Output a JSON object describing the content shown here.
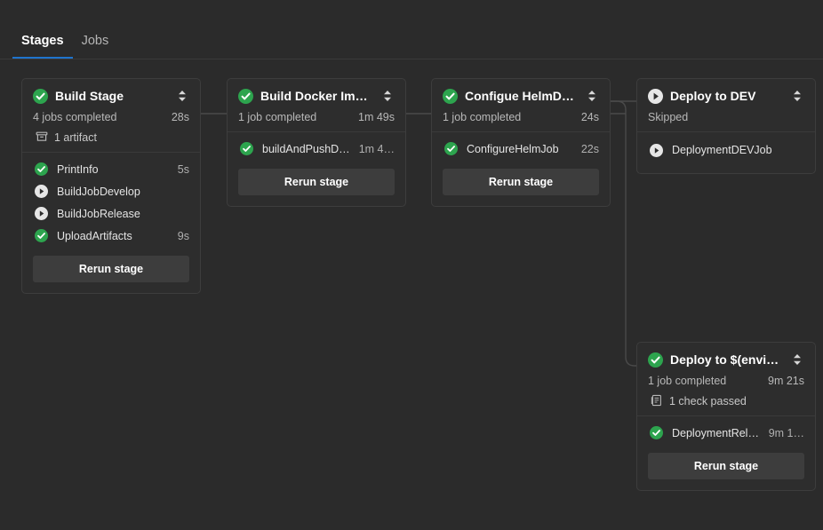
{
  "theme": {
    "background": "#2b2b2b",
    "card_background": "#2d2d2d",
    "border": "#3d3d3d",
    "accent": "#1f74cd",
    "success": "#2da44e",
    "button": "#3d3d3d",
    "text_primary": "#ffffff",
    "text_secondary": "#b8b8b8"
  },
  "tabs": [
    {
      "label": "Stages",
      "name": "tab-stages",
      "active": true
    },
    {
      "label": "Jobs",
      "name": "tab-jobs",
      "active": false
    }
  ],
  "labels": {
    "rerun_stage": "Rerun stage",
    "toggle_icon": "chevron-up-down-icon",
    "success_icon": "check-circle-icon",
    "skipped_icon": "skipped-circle-icon",
    "artifact_icon": "artifact-box-icon",
    "check_icon": "checklist-icon"
  },
  "stages": [
    {
      "id": "build-stage",
      "title": "Build Stage",
      "status": "success",
      "summary": "4 jobs completed",
      "duration": "28s",
      "extra": {
        "icon": "artifact-box-icon",
        "text": "1 artifact"
      },
      "jobs": [
        {
          "name": "PrintInfo",
          "status": "success",
          "duration": "5s"
        },
        {
          "name": "BuildJobDevelop",
          "status": "skipped",
          "duration": ""
        },
        {
          "name": "BuildJobRelease",
          "status": "skipped",
          "duration": ""
        },
        {
          "name": "UploadArtifacts",
          "status": "success",
          "duration": "9s"
        }
      ],
      "rerun": "Rerun stage"
    },
    {
      "id": "build-docker-image",
      "title": "Build Docker Image",
      "status": "success",
      "summary": "1 job completed",
      "duration": "1m 49s",
      "extra": null,
      "jobs": [
        {
          "name": "buildAndPushDocker…",
          "status": "success",
          "duration": "1m 4…"
        }
      ],
      "rerun": "Rerun stage"
    },
    {
      "id": "configue-helm-deployment",
      "title": "Configue HelmDepl…",
      "status": "success",
      "summary": "1 job completed",
      "duration": "24s",
      "extra": null,
      "jobs": [
        {
          "name": "ConfigureHelmJob",
          "status": "success",
          "duration": "22s"
        }
      ],
      "rerun": "Rerun stage"
    },
    {
      "id": "deploy-to-dev",
      "title": "Deploy to DEV",
      "status": "skipped",
      "summary": "Skipped",
      "duration": "",
      "extra": null,
      "jobs": [
        {
          "name": "DeploymentDEVJob",
          "status": "skipped",
          "duration": ""
        }
      ],
      "rerun": null
    },
    {
      "id": "deploy-to-environment",
      "title": "Deploy to $(environ…",
      "status": "success",
      "summary": "1 job completed",
      "duration": "9m 21s",
      "extra": {
        "icon": "checklist-icon",
        "text": "1 check passed"
      },
      "jobs": [
        {
          "name": "DeploymentReleaseJ…",
          "status": "success",
          "duration": "9m 1…"
        }
      ],
      "rerun": "Rerun stage"
    }
  ]
}
